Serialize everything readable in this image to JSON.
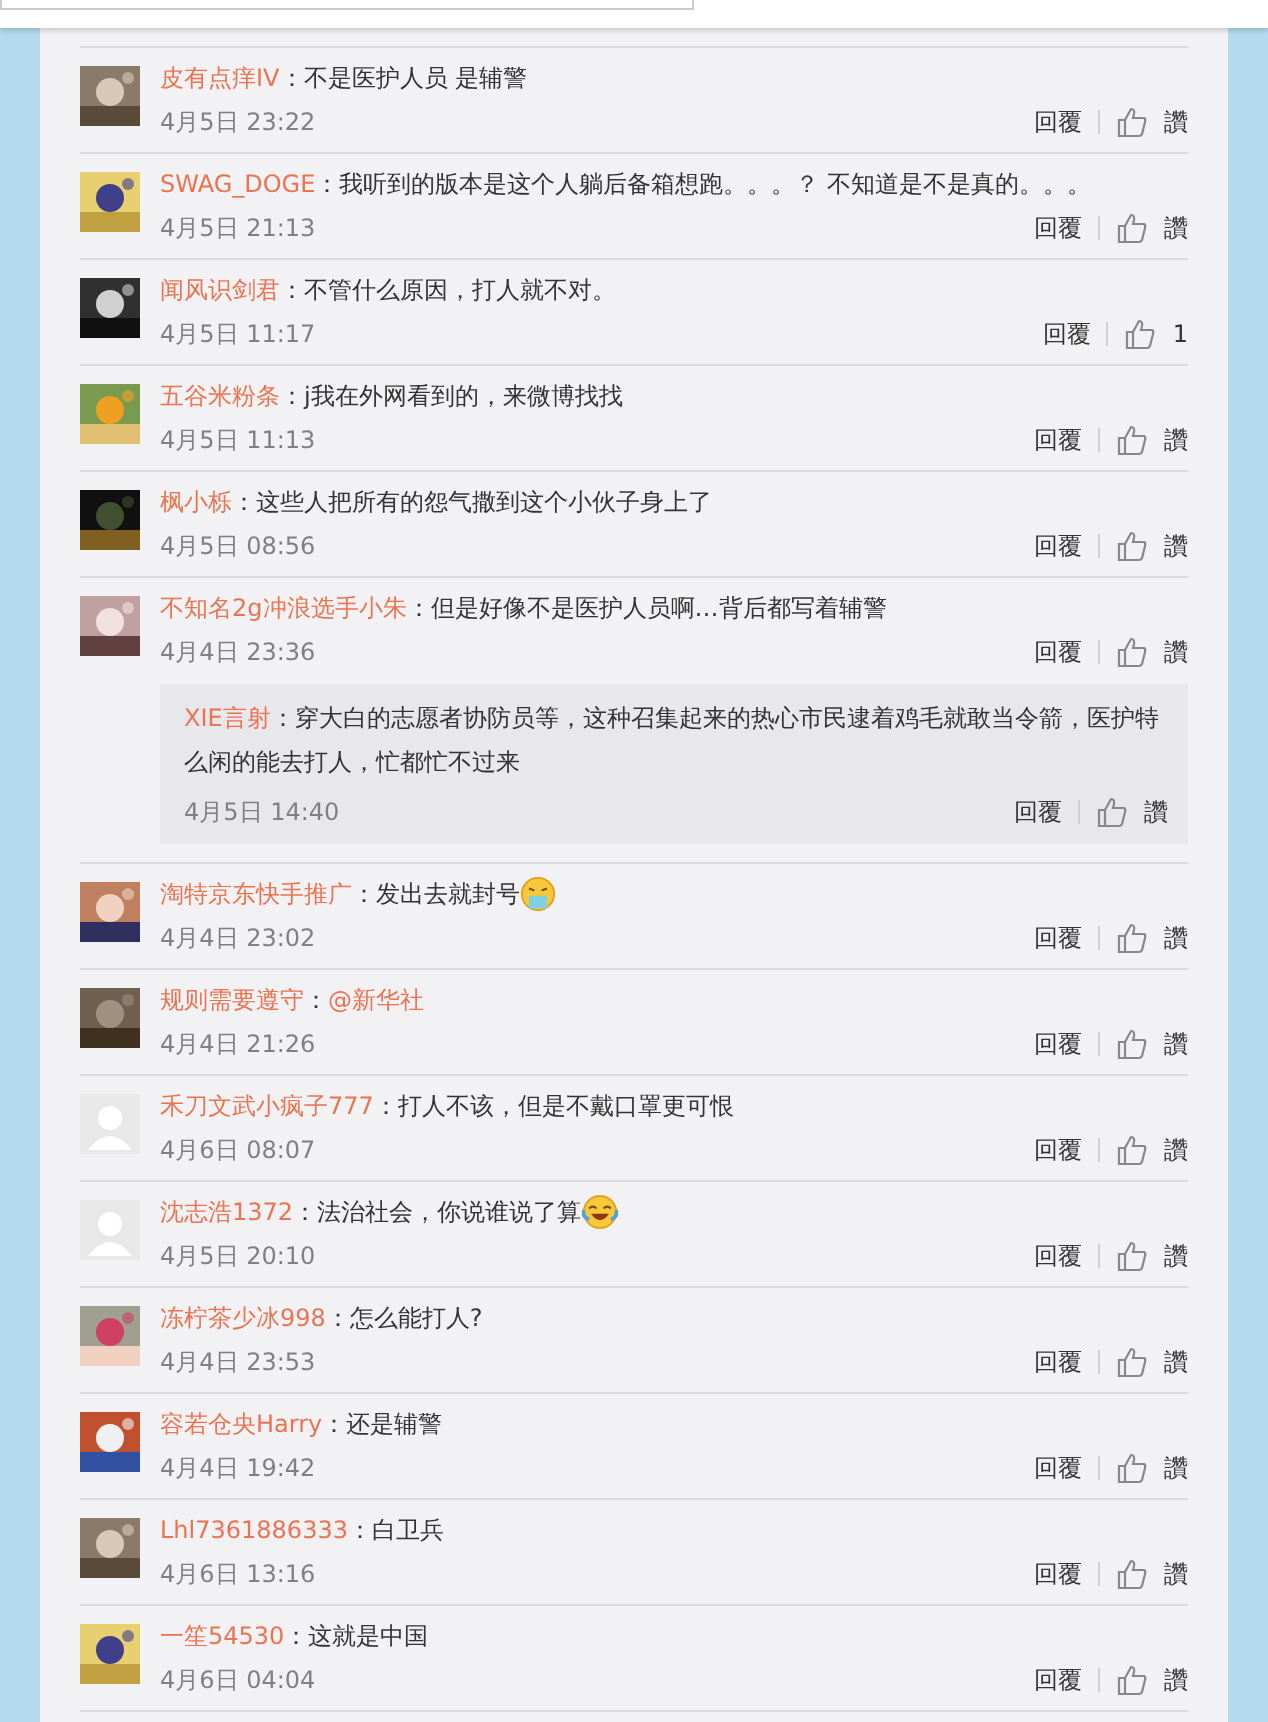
{
  "comments": [
    {
      "name": "皮有点痒IV",
      "text": "：不是医护人员 是辅警",
      "time": "4月5日 23:22",
      "reply": "回覆",
      "like": "讚"
    },
    {
      "name": "SWAG_DOGE",
      "text": "：我听到的版本是这个人躺后备箱想跑。。。？ 不知道是不是真的。。。",
      "time": "4月5日 21:13",
      "reply": "回覆",
      "like": "讚"
    },
    {
      "name": "闻风识剑君",
      "text": "：不管什么原因，打人就不对。",
      "time": "4月5日 11:17",
      "reply": "回覆",
      "like": "1"
    },
    {
      "name": "五谷米粉条",
      "text": "：j我在外网看到的，来微博找找",
      "time": "4月5日 11:13",
      "reply": "回覆",
      "like": "讚"
    },
    {
      "name": "枫小栎",
      "text": "：这些人把所有的怨气撒到这个小伙子身上了",
      "time": "4月5日 08:56",
      "reply": "回覆",
      "like": "讚"
    },
    {
      "name": "不知名2g冲浪选手小朱",
      "text": "：但是好像不是医护人员啊…背后都写着辅警",
      "time": "4月4日 23:36",
      "reply": "回覆",
      "like": "讚",
      "replies": [
        {
          "name": "XIE言射",
          "text": "：穿大白的志愿者协防员等，这种召集起来的热心市民逮着鸡毛就敢当令箭，医护特么闲的能去打人，忙都忙不过来",
          "time": "4月5日 14:40",
          "reply": "回覆",
          "like": "讚"
        }
      ]
    },
    {
      "name": "淘特京东快手推广",
      "text": "：发出去就封号",
      "emoji": {
        "kind": "yuck"
      },
      "time": "4月4日 23:02",
      "reply": "回覆",
      "like": "讚"
    },
    {
      "name": "规则需要遵守",
      "text": "：",
      "mention": "@新华社",
      "time": "4月4日 21:26",
      "reply": "回覆",
      "like": "讚"
    },
    {
      "avatar": {
        "kind": "default"
      },
      "name": "禾刀文武小疯子777",
      "text": "：打人不该，但是不戴口罩更可恨",
      "time": "4月6日 08:07",
      "reply": "回覆",
      "like": "讚"
    },
    {
      "avatar": {
        "kind": "default"
      },
      "name": "沈志浩1372",
      "text": "：法治社会，你说谁说了算",
      "emoji": {
        "kind": "tears"
      },
      "time": "4月5日 20:10",
      "reply": "回覆",
      "like": "讚"
    },
    {
      "name": "冻柠茶少冰998",
      "text": "：怎么能打人?",
      "time": "4月4日 23:53",
      "reply": "回覆",
      "like": "讚"
    },
    {
      "name": "容若仓央Harry",
      "text": "：还是辅警",
      "time": "4月4日 19:42",
      "reply": "回覆",
      "like": "讚"
    },
    {
      "name": "Lhl7361886333",
      "text": "：白卫兵",
      "time": "4月6日 13:16",
      "reply": "回覆",
      "like": "讚"
    },
    {
      "name": "一笙54530",
      "text": "：这就是中国",
      "time": "4月6日 04:04",
      "reply": "回覆",
      "like": "讚"
    }
  ]
}
